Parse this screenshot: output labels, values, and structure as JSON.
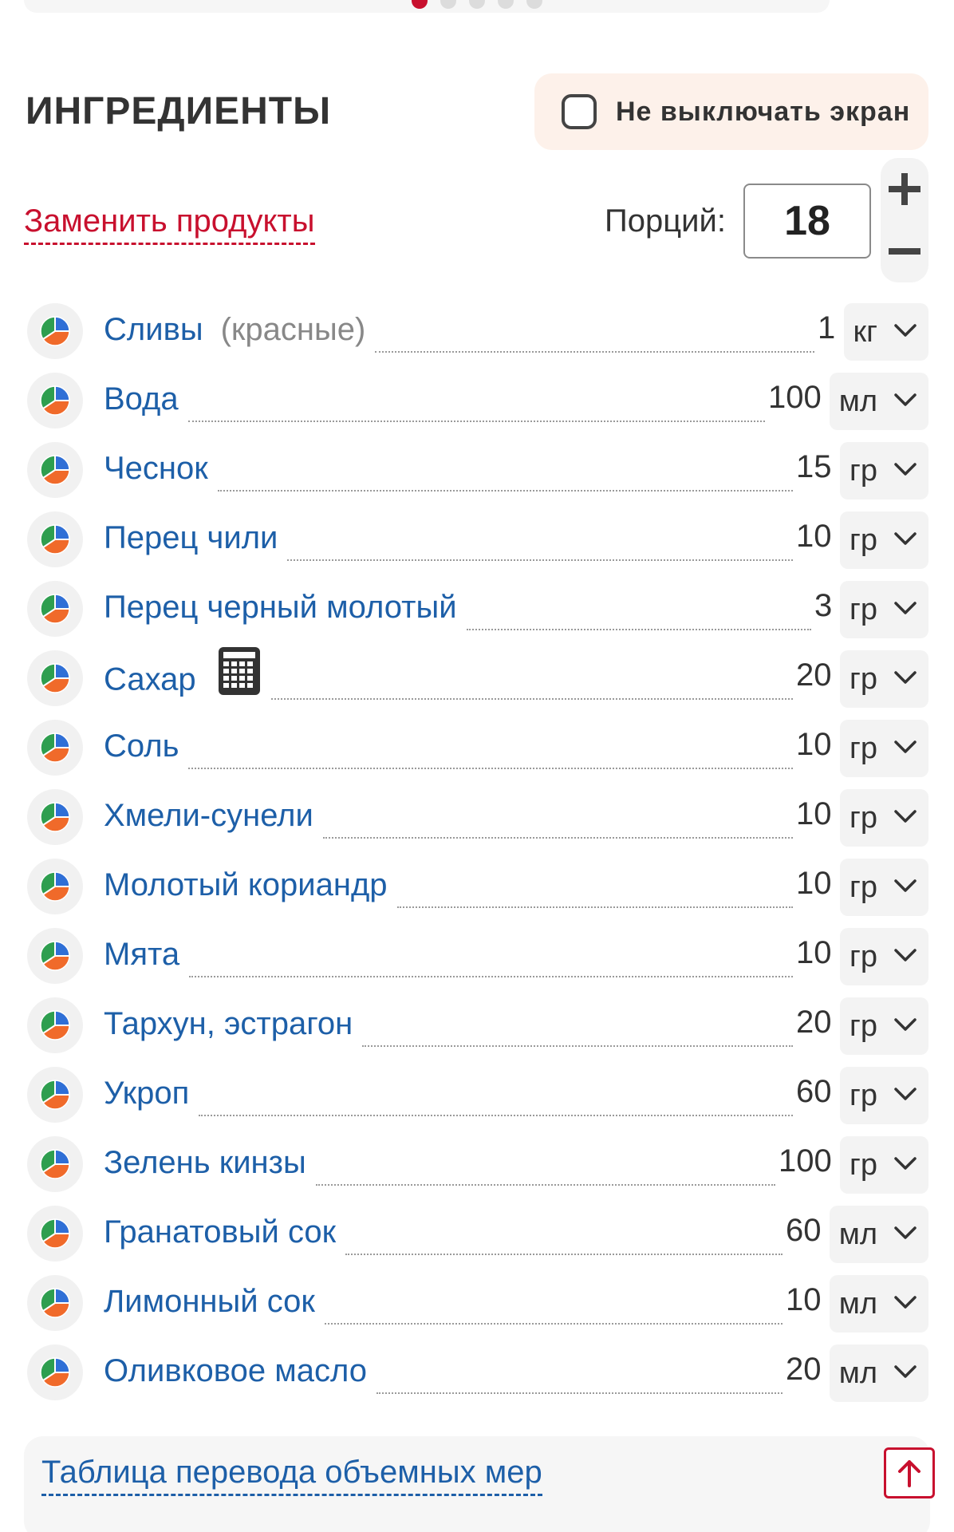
{
  "header": {
    "title": "ИНГРЕДИЕНТЫ",
    "keep_screen_label": "Не выключать экран",
    "keep_screen_checked": false
  },
  "carousel": {
    "dots_total": 5,
    "active_index": 0
  },
  "controls": {
    "replace_link": "Заменить продукты",
    "portions_label": "Порций:",
    "portions_value": "18"
  },
  "ingredients": [
    {
      "name": "Сливы",
      "note": "(красные)",
      "qty": "1",
      "unit": "кг",
      "calculator": false
    },
    {
      "name": "Вода",
      "qty": "100",
      "unit": "мл",
      "calculator": false
    },
    {
      "name": "Чеснок",
      "qty": "15",
      "unit": "гр",
      "calculator": false
    },
    {
      "name": "Перец чили",
      "qty": "10",
      "unit": "гр",
      "calculator": false
    },
    {
      "name": "Перец черный молотый",
      "qty": "3",
      "unit": "гр",
      "calculator": false
    },
    {
      "name": "Сахар",
      "qty": "20",
      "unit": "гр",
      "calculator": true
    },
    {
      "name": "Соль",
      "qty": "10",
      "unit": "гр",
      "calculator": false
    },
    {
      "name": "Хмели-сунели",
      "qty": "10",
      "unit": "гр",
      "calculator": false
    },
    {
      "name": "Молотый кориандр",
      "qty": "10",
      "unit": "гр",
      "calculator": false
    },
    {
      "name": "Мята",
      "qty": "10",
      "unit": "гр",
      "calculator": false
    },
    {
      "name": "Тархун, эстрагон",
      "qty": "20",
      "unit": "гр",
      "calculator": false
    },
    {
      "name": "Укроп",
      "qty": "60",
      "unit": "гр",
      "calculator": false
    },
    {
      "name": "Зелень кинзы",
      "qty": "100",
      "unit": "гр",
      "calculator": false
    },
    {
      "name": "Гранатовый сок",
      "qty": "60",
      "unit": "мл",
      "calculator": false
    },
    {
      "name": "Лимонный сок",
      "qty": "10",
      "unit": "мл",
      "calculator": false
    },
    {
      "name": "Оливковое масло",
      "qty": "20",
      "unit": "мл",
      "calculator": false
    }
  ],
  "footer": {
    "measures_link": "Таблица перевода объемных мер"
  },
  "icons": {
    "nutrition": "nutrition-pie-icon",
    "calculator": "calculator-icon",
    "chevron": "chevron-down-icon",
    "plus": "plus-icon",
    "minus": "minus-icon",
    "scroll_top": "arrow-up-icon"
  },
  "colors": {
    "accent_red": "#c8102e",
    "link_blue": "#1d5fa8",
    "pie_green": "#2e9e4f",
    "pie_blue": "#2f6fd6",
    "pie_orange": "#f06a2a"
  }
}
